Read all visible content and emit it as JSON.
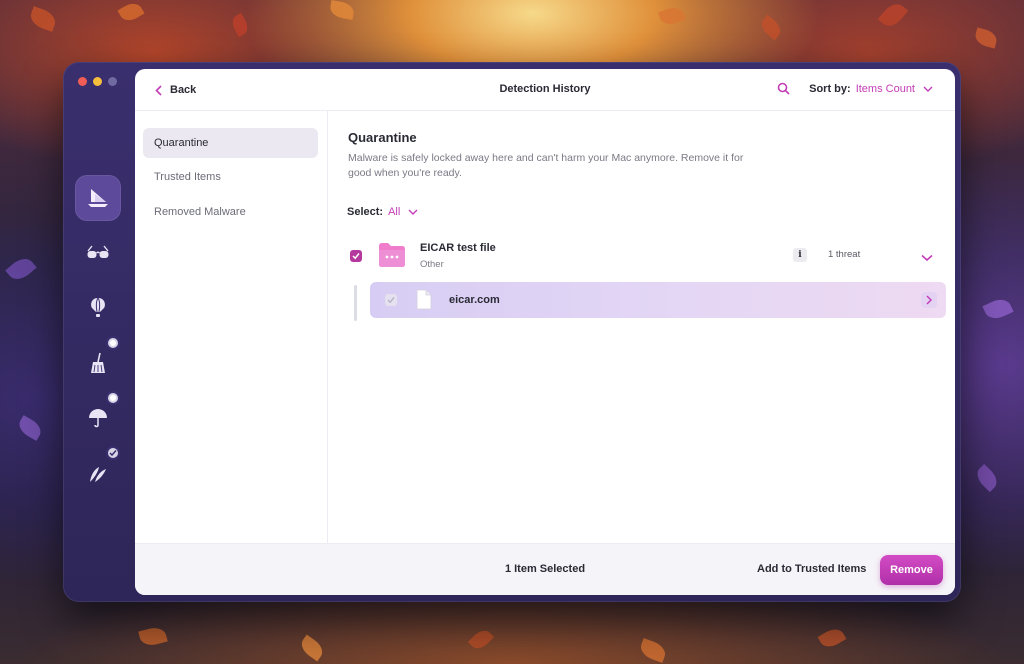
{
  "window": {
    "title": "Detection History",
    "back_label": "Back",
    "sort": {
      "label": "Sort by:",
      "value": "Items Count"
    }
  },
  "rail": {
    "items": [
      {
        "icon": "quarantine-ship-icon",
        "active": true
      },
      {
        "icon": "glasses-icon"
      },
      {
        "icon": "hot-air-balloon-icon"
      },
      {
        "icon": "broom-icon",
        "badge": "dot"
      },
      {
        "icon": "umbrella-icon",
        "badge": "dot"
      },
      {
        "icon": "feathers-icon",
        "badge": "check"
      }
    ]
  },
  "sidebar": {
    "items": [
      {
        "label": "Quarantine",
        "active": true
      },
      {
        "label": "Trusted Items"
      },
      {
        "label": "Removed Malware"
      }
    ]
  },
  "section": {
    "title": "Quarantine",
    "description": "Malware is safely locked away here and can't harm your Mac anymore. Remove it for good when you're ready.",
    "select_label": "Select:",
    "select_value": "All"
  },
  "item": {
    "name": "EICAR test file",
    "category": "Other",
    "info_label": "i",
    "threat_count": "1 threat",
    "checked": true,
    "children": [
      {
        "name": "eicar.com"
      }
    ]
  },
  "footer": {
    "selection_text": "1 Item Selected",
    "trusted_label": "Add to Trusted Items",
    "remove_label": "Remove"
  },
  "colors": {
    "accent": "#c43db8",
    "remove_button": "#c23cb6",
    "sidebar_active": "#ebe8f1",
    "window_chrome": "#3a2f6e"
  }
}
